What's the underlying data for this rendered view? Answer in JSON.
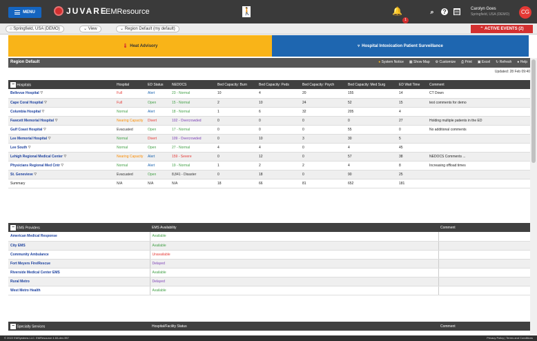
{
  "topbar": {
    "menu_label": "MENU",
    "logo_text": "JUVARE",
    "app_name": "EMResource",
    "bell_count": "1",
    "user_name": "Carolyn Goes",
    "user_location": "Springfield, USA (DEMO)",
    "user_initials": "CG"
  },
  "subbar": {
    "region_chip": "Springfield, USA (DEMO)",
    "view_chip": "View",
    "default_chip": "Region Default (my default)",
    "active_events": "ACTIVE EVENTS (2)"
  },
  "tabs": {
    "heat_advisory": "Heat Advisory",
    "surveillance": "Hospital Intoxication Patient Surveillance"
  },
  "region": {
    "title": "Region Default",
    "updated": "Updated: 28 Feb 09:40",
    "tools": [
      "System Notice",
      "Show Map",
      "Customize",
      "Print",
      "Excel",
      "Refresh",
      "Help"
    ]
  },
  "hospitals": {
    "headers": [
      "Hospitals",
      "Hospital",
      "ED Status",
      "NEDOCS",
      "Bed Capacity: Burn",
      "Bed Capacity: Peds",
      "Bed Capacity: Psych",
      "Bed Capacity: Med Surg",
      "ED Wait Time",
      "Comment"
    ],
    "rows": [
      [
        "Bellevue Hospital",
        "Full",
        "Alert",
        "23 - Normal",
        "10",
        "4",
        "20",
        "155",
        "14",
        "CT Down"
      ],
      [
        "Cape Coral Hospital",
        "Full",
        "Open",
        "15 - Normal",
        "2",
        "10",
        "24",
        "52",
        "15",
        "test comments for demo"
      ],
      [
        "Columbia Hospital",
        "Normal",
        "Alert",
        "18 - Normal",
        "1",
        "6",
        "32",
        "205",
        "4",
        ""
      ],
      [
        "Fawcett Memorial Hospital",
        "Nearing Capacity",
        "Divert",
        "102 - Overcrowded",
        "0",
        "0",
        "0",
        "0",
        "27",
        "Holding multiple patients in the ED"
      ],
      [
        "Gulf Coast Hospital",
        "Evacuated",
        "Open",
        "17 - Normal",
        "0",
        "0",
        "0",
        "55",
        "0",
        "No additional comments"
      ],
      [
        "Lee Memorial Hospital",
        "Normal",
        "Divert",
        "109 - Overcrowded",
        "0",
        "10",
        "3",
        "30",
        "5",
        ""
      ],
      [
        "Lee South",
        "Normal",
        "Open",
        "27 - Normal",
        "4",
        "4",
        "0",
        "4",
        "45",
        ""
      ],
      [
        "Lehigh Regional Medical Center",
        "Nearing Capacity",
        "Alert",
        "159 - Severe",
        "0",
        "12",
        "0",
        "57",
        "38",
        "NEDOCS Comments ..."
      ],
      [
        "Physicians Regional Med Cntr",
        "Normal",
        "Alert",
        "19 - Normal",
        "1",
        "2",
        "2",
        "4",
        "8",
        "Increasing offload times"
      ],
      [
        "St. Genevieve",
        "Evacuated",
        "Open",
        "8,841 - Disaster",
        "0",
        "18",
        "0",
        "90",
        "25",
        ""
      ],
      [
        "Summary",
        "N/A",
        "N/A",
        "N/A",
        "18",
        "66",
        "81",
        "652",
        "181",
        ""
      ]
    ]
  },
  "ems": {
    "headers": [
      "EMS Providers",
      "EMS Availability",
      "Comment"
    ],
    "rows": [
      [
        "American Medical Response",
        "Available"
      ],
      [
        "City EMS",
        "Available"
      ],
      [
        "Community Ambulance",
        "Unavailable"
      ],
      [
        "Fort Meyers Fire/Rescue",
        "Delayed"
      ],
      [
        "Riverside Medical Center EMS",
        "Available"
      ],
      [
        "Rural Metro",
        "Delayed"
      ],
      [
        "West Metro Health",
        "Available"
      ]
    ]
  },
  "specialty": {
    "headers": [
      "Specialty Services",
      "Hospital/Facility Status",
      "Comment"
    ]
  },
  "footer": {
    "left": "© 2022 EMSystems LLC. EMResource 4.60-dev-957",
    "right": "Privacy Policy | Terms and Conditions"
  },
  "colors": {
    "Full": "#e53935",
    "Normal": "#43a047",
    "Nearing Capacity": "#fb8c00",
    "Evacuated": "#333333",
    "N/A": "#333333",
    "Alert": "#1e66b0",
    "Open": "#43a047",
    "Divert": "#e53935",
    "Available": "#43a047",
    "Unavailable": "#e53935",
    "Delayed": "#7b3fb5",
    "Normal-ned": "#43a047",
    "Busy": "#f9b418",
    "Overcrowded": "#7b3fb5",
    "Severe": "#e53935",
    "Disaster": "#333333"
  }
}
